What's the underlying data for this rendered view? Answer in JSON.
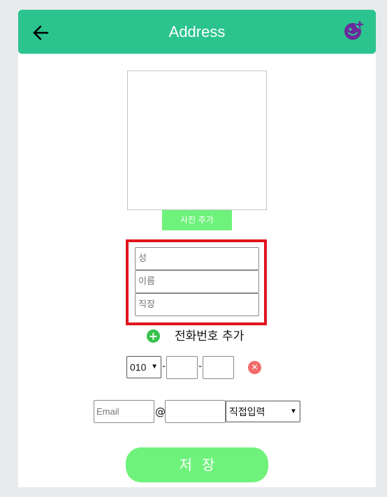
{
  "header": {
    "title": "Address",
    "back_icon": "arrow-left-icon",
    "add_user_icon": "add-user-icon",
    "bg_color": "#2bc48e",
    "icon_accent_color": "#6a2a9c"
  },
  "photo": {
    "button_label": "사진 추가"
  },
  "name_fields": {
    "last_name_placeholder": "성",
    "first_name_placeholder": "이름",
    "company_placeholder": "직장",
    "highlight_color": "#e0141d"
  },
  "phone": {
    "add_label": "전화번호 추가",
    "prefix_selected": "010",
    "separator": "-"
  },
  "email": {
    "local_placeholder": "Email",
    "at_symbol": "@",
    "domain_select_selected": "직접입력"
  },
  "save_button": {
    "label": "저장",
    "color": "#6ff27c"
  }
}
